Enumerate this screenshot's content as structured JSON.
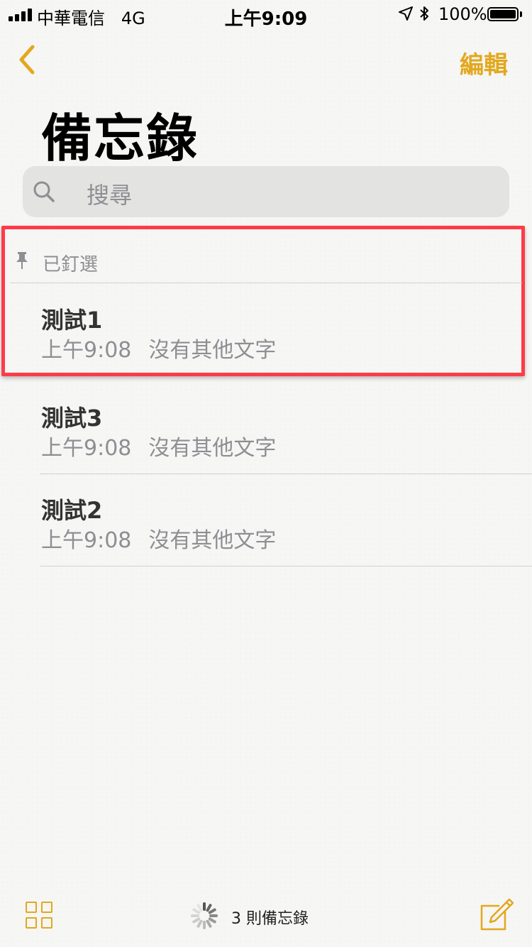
{
  "status_bar": {
    "carrier": "中華電信",
    "network": "4G",
    "time": "上午9:09",
    "battery": "100%",
    "icons": [
      "signal-icon",
      "location-icon",
      "bluetooth-icon",
      "battery-icon"
    ]
  },
  "nav": {
    "back_icon": "chevron-left-icon",
    "edit_label": "編輯"
  },
  "page_title": "備忘錄",
  "search": {
    "placeholder": "搜尋",
    "icon": "search-icon"
  },
  "pinned": {
    "section_label": "已釘選",
    "icon": "pin-icon",
    "notes": [
      {
        "title": "測試1",
        "time": "上午9:08",
        "preview": "沒有其他文字"
      }
    ]
  },
  "notes": [
    {
      "title": "測試3",
      "time": "上午9:08",
      "preview": "沒有其他文字"
    },
    {
      "title": "測試2",
      "time": "上午9:08",
      "preview": "沒有其他文字"
    }
  ],
  "toolbar": {
    "attachments_icon": "grid-icon",
    "count_label": "3 則備忘錄",
    "compose_icon": "compose-icon"
  },
  "colors": {
    "accent": "#e2a81e",
    "highlight": "#ff3b47",
    "secondary_text": "#8e8e93"
  }
}
